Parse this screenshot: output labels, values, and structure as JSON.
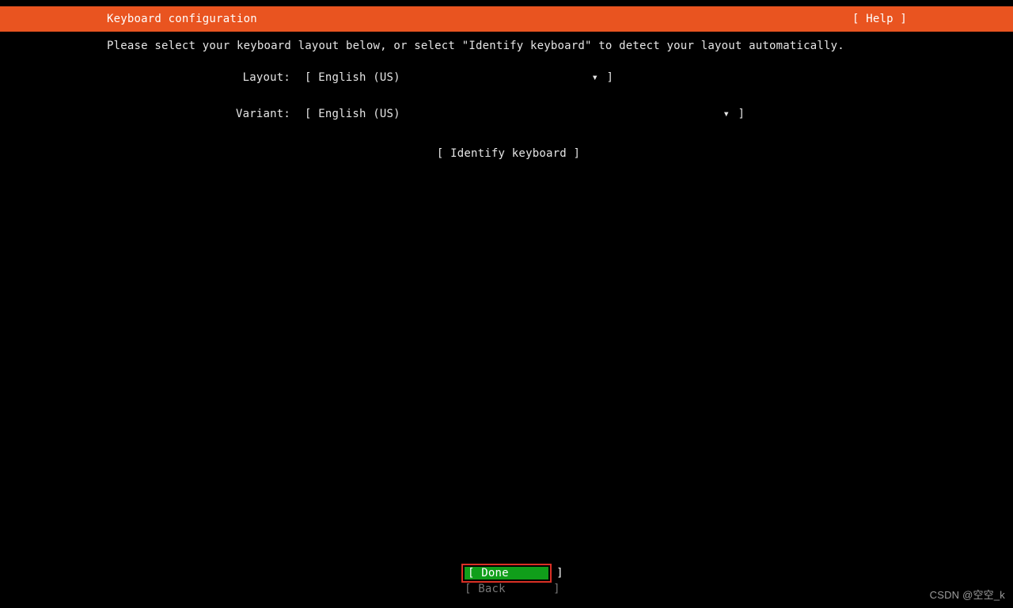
{
  "header": {
    "title": "Keyboard configuration",
    "help": "[ Help ]"
  },
  "instruction": "Please select your keyboard layout below, or select \"Identify keyboard\" to detect your layout automatically.",
  "form": {
    "layout_label": "Layout:",
    "layout_value": "English (US)",
    "variant_label": "Variant:",
    "variant_value": "English (US)",
    "dropdown_glyph": "▾"
  },
  "identify_button": "[ Identify keyboard ]",
  "buttons": {
    "done": "[ Done       ]",
    "back": "[ Back       ]"
  },
  "watermark": "CSDN @空空_k"
}
